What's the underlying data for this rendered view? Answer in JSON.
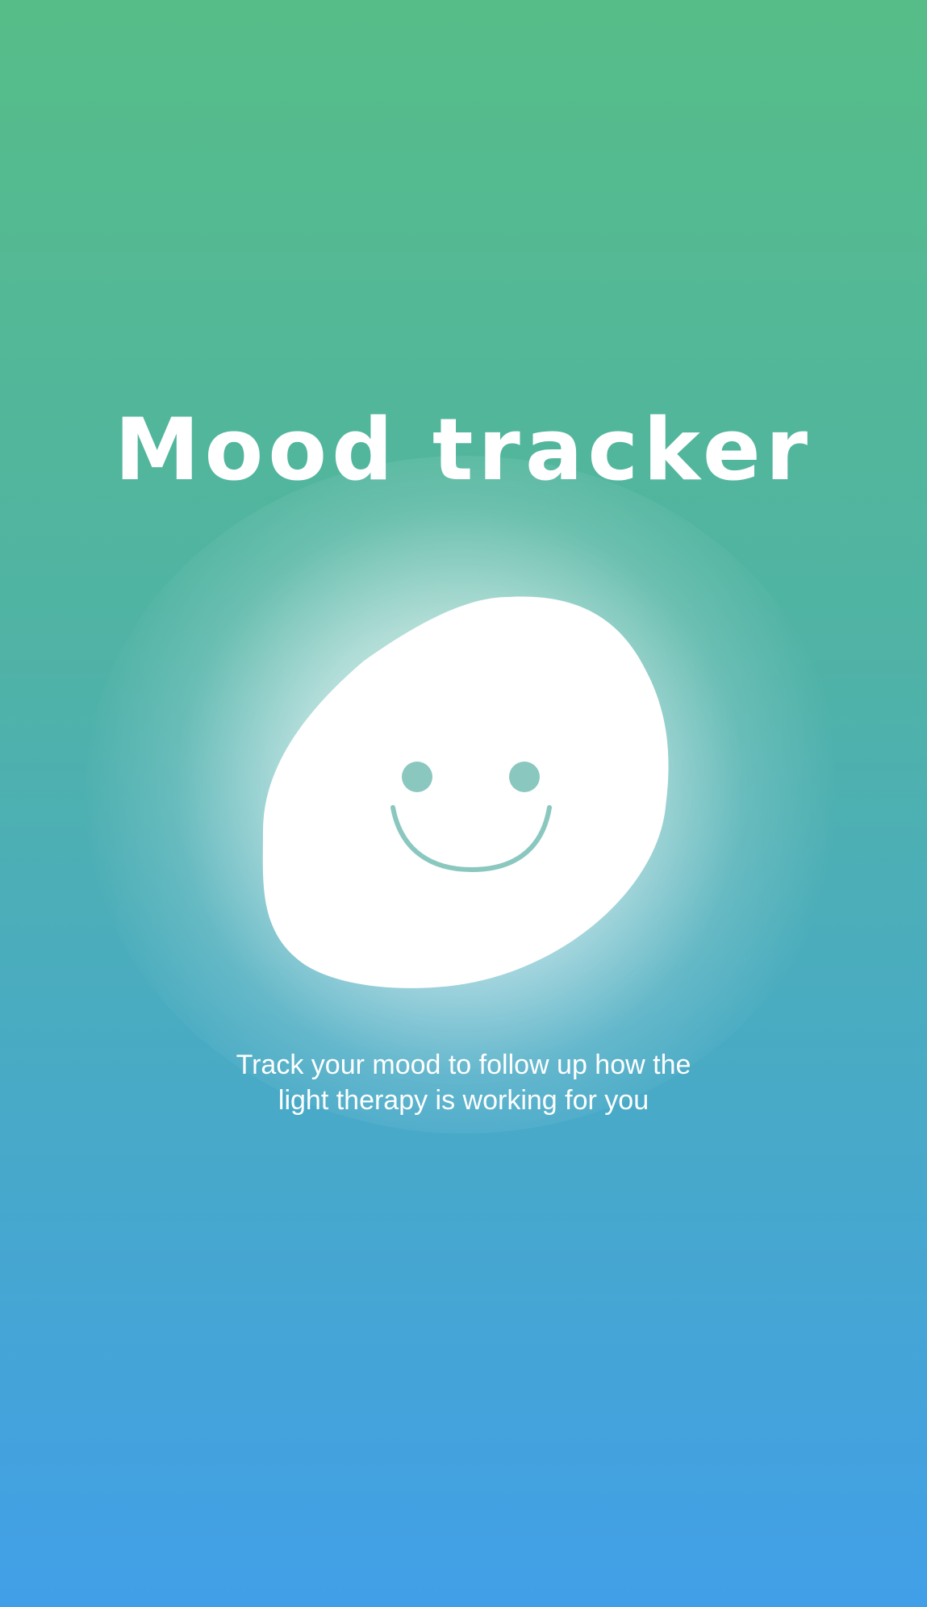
{
  "title": "Mood tracker",
  "subtitle_lines": [
    "Track your mood to follow up how the",
    "light therapy is working for you"
  ],
  "icon": "smiley-face-icon",
  "colors": {
    "gradient_top": "#56bd88",
    "gradient_bottom": "#419fe8",
    "face_features": "#8ac8bf",
    "blob": "#ffffff"
  }
}
